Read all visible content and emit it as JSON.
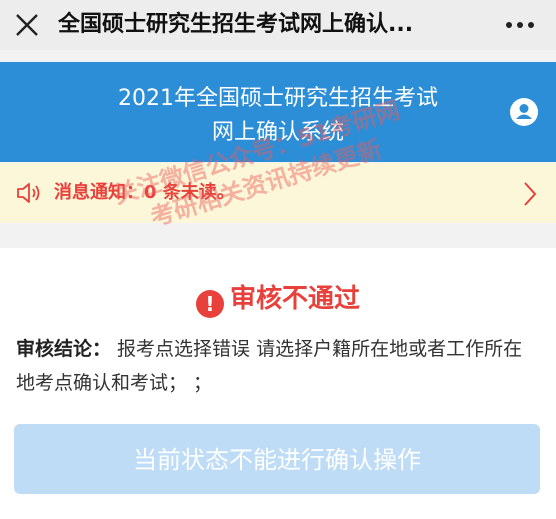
{
  "topbar": {
    "title": "全国硕士研究生招生考试网上确认..."
  },
  "header": {
    "line1": "2021年全国硕士研究生招生考试",
    "line2": "网上确认系统"
  },
  "notice": {
    "text": "消息通知：0 条未读。"
  },
  "watermark": {
    "line1": "关注微信公众号：51考研网",
    "line2": "考研相关资讯持续更新"
  },
  "result": {
    "status": "审核不通过",
    "label": "审核结论：",
    "text": " 报考点选择错误 请选择户籍所在地或者工作所在地考点确认和考试； ；"
  },
  "action": {
    "button_label": "当前状态不能进行确认操作"
  },
  "colors": {
    "header_bg": "#2d8ed8",
    "notice_bg": "#fdf7d9",
    "error": "#e8413b",
    "button_disabled": "#bedcf5"
  }
}
